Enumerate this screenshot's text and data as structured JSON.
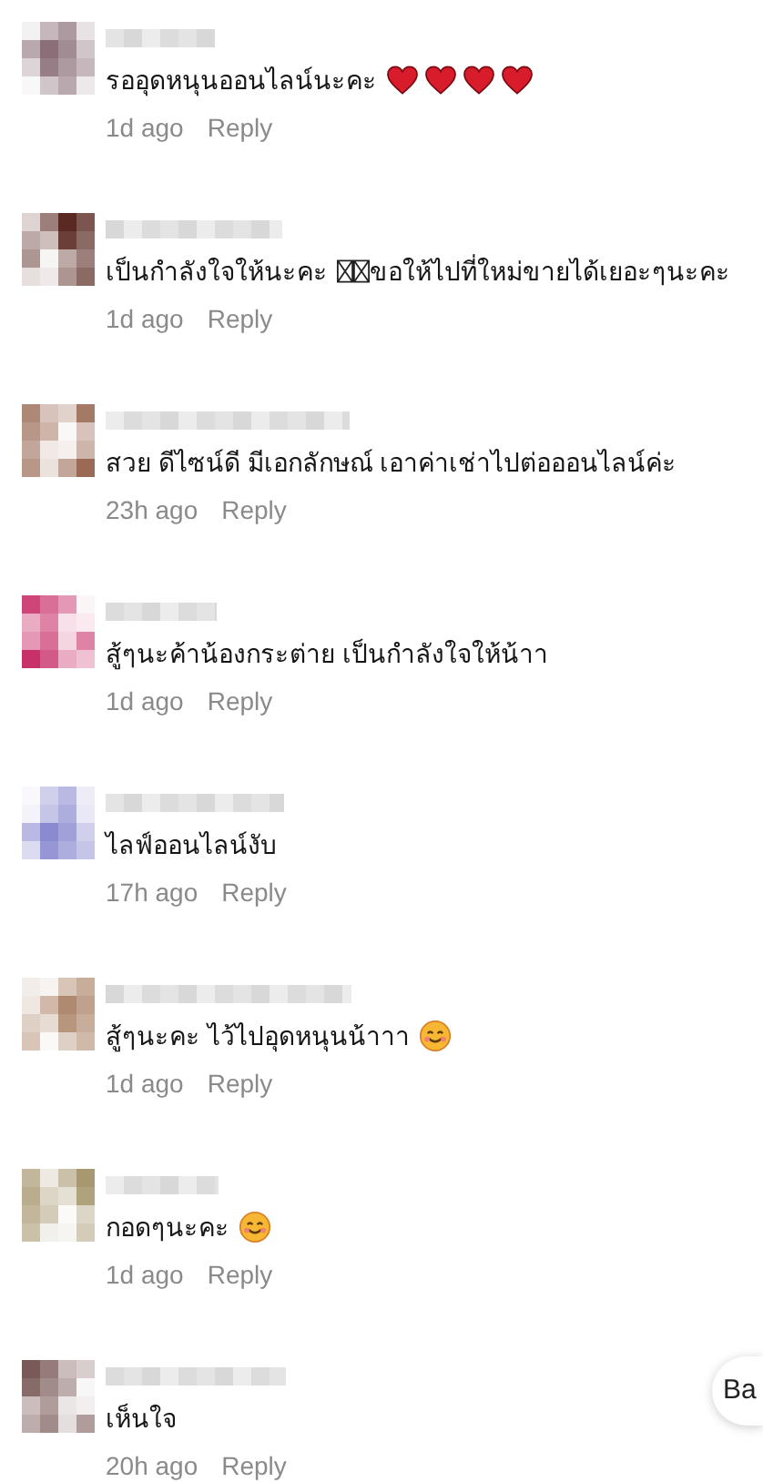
{
  "comments": [
    {
      "color": "#8a6f78",
      "parts": [
        {
          "kind": "text",
          "text": "รออุดหนุนออนไลน์นะคะ"
        },
        {
          "kind": "heart"
        },
        {
          "kind": "heart"
        },
        {
          "kind": "heart"
        },
        {
          "kind": "heart"
        }
      ],
      "time": "1d ago",
      "reply": "Reply"
    },
    {
      "color": "#5a2a22",
      "parts": [
        {
          "kind": "text",
          "text": "เป็นกำลังใจให้นะคะ"
        },
        {
          "kind": "tofu"
        },
        {
          "kind": "tofu"
        },
        {
          "kind": "text",
          "text": "ขอให้ไปที่ใหม่ขายได้เยอะๆนะคะ"
        }
      ],
      "time": "1d ago",
      "reply": "Reply"
    },
    {
      "color": "#9a6a55",
      "parts": [
        {
          "kind": "text",
          "text": "สวย ดีไซน์ดี มีเอกลักษณ์ เอาค่าเช่าไปต่อออนไลน์ค่ะ"
        }
      ],
      "time": "23h ago",
      "reply": "Reply"
    },
    {
      "color": "#c8306a",
      "parts": [
        {
          "kind": "text",
          "text": "สู้ๆนะค้าน้องกระต่าย เป็นกำลังใจให้น้าา"
        }
      ],
      "time": "1d ago",
      "reply": "Reply"
    },
    {
      "color": "#8a8ad0",
      "parts": [
        {
          "kind": "text",
          "text": "ไลฟ์ออนไลน์งับ"
        }
      ],
      "time": "17h ago",
      "reply": "Reply"
    },
    {
      "color": "#b08a70",
      "parts": [
        {
          "kind": "text",
          "text": "สู้ๆนะคะ ไว้ไปอุดหนุนน้าาา"
        },
        {
          "kind": "smile"
        }
      ],
      "time": "1d ago",
      "reply": "Reply"
    },
    {
      "color": "#a89870",
      "parts": [
        {
          "kind": "text",
          "text": "กอดๆนะคะ"
        },
        {
          "kind": "smile"
        }
      ],
      "time": "1d ago",
      "reply": "Reply"
    },
    {
      "color": "#7a5a58",
      "parts": [
        {
          "kind": "text",
          "text": "เห็นใจ"
        }
      ],
      "time": "20h ago",
      "reply": "Reply"
    }
  ],
  "floating_button": {
    "label": "Ba"
  }
}
